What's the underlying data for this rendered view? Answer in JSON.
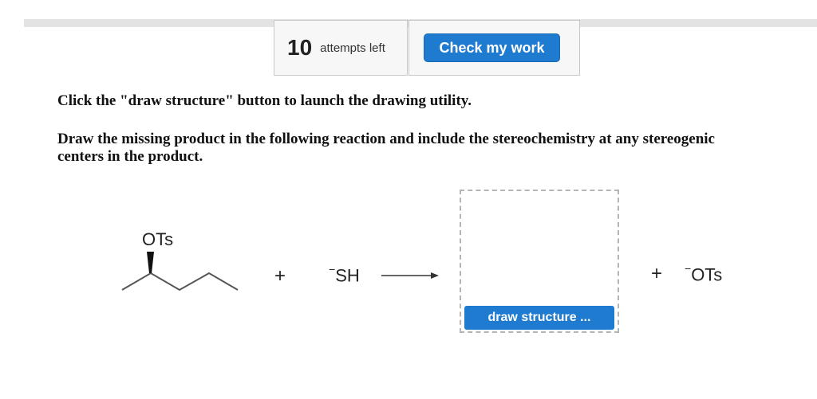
{
  "header": {
    "attempts_count": "10",
    "attempts_label": "attempts left",
    "check_button_label": "Check my work"
  },
  "instructions": {
    "line1": "Click the \"draw structure\" button to launch the drawing utility.",
    "line2": "Draw the missing product in the following reaction and include the stereochemistry at any stereogenic centers in the product."
  },
  "reaction": {
    "reactant_label": "OTs",
    "plus1": "+",
    "nucleophile_charge": "−",
    "nucleophile": "SH",
    "plus2": "+",
    "leaving_group_charge": "−",
    "leaving_group": "OTs",
    "draw_button_label": "draw structure ..."
  },
  "colors": {
    "accent": "#1f7bd0"
  }
}
